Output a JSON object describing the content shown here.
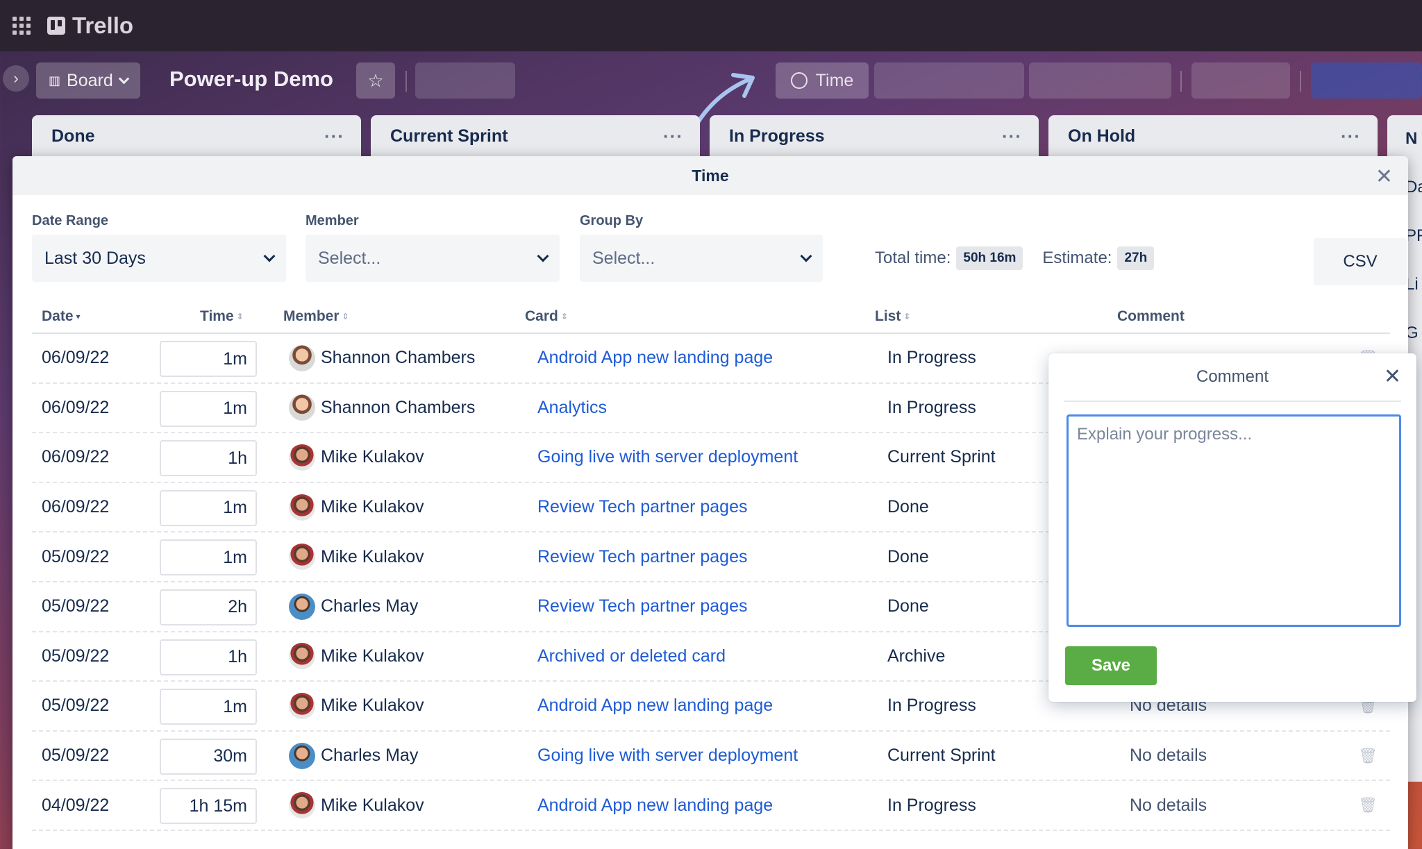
{
  "app": {
    "name": "Trello"
  },
  "board": {
    "view_label": "Board",
    "title": "Power-up Demo",
    "time_button_label": "Time"
  },
  "lists": [
    {
      "name": "Done"
    },
    {
      "name": "Current Sprint"
    },
    {
      "name": "In Progress"
    },
    {
      "name": "On Hold"
    },
    {
      "name": "N"
    }
  ],
  "right_list_fragments": [
    "Da",
    "PF",
    "Li",
    "G"
  ],
  "modal": {
    "title": "Time",
    "filters": {
      "date_range": {
        "label": "Date Range",
        "value": "Last 30 Days"
      },
      "member": {
        "label": "Member",
        "placeholder": "Select..."
      },
      "group_by": {
        "label": "Group By",
        "placeholder": "Select..."
      }
    },
    "totals": {
      "total_label": "Total time:",
      "total_value": "50h 16m",
      "estimate_label": "Estimate:",
      "estimate_value": "27h"
    },
    "csv_label": "CSV",
    "columns": [
      "Date",
      "Time",
      "Member",
      "Card",
      "List",
      "Comment"
    ],
    "rows": [
      {
        "date": "06/09/22",
        "time": "1m",
        "member": "Shannon Chambers",
        "avatar": "sc",
        "card": "Android App new landing page",
        "list": "In Progress",
        "comment": ""
      },
      {
        "date": "06/09/22",
        "time": "1m",
        "member": "Shannon Chambers",
        "avatar": "sc",
        "card": "Analytics",
        "list": "In Progress",
        "comment": ""
      },
      {
        "date": "06/09/22",
        "time": "1h",
        "member": "Mike Kulakov",
        "avatar": "mk",
        "card": "Going live with server deployment",
        "list": "Current Sprint",
        "comment": ""
      },
      {
        "date": "06/09/22",
        "time": "1m",
        "member": "Mike Kulakov",
        "avatar": "mk",
        "card": "Review Tech partner pages",
        "list": "Done",
        "comment": ""
      },
      {
        "date": "05/09/22",
        "time": "1m",
        "member": "Mike Kulakov",
        "avatar": "mk",
        "card": "Review Tech partner pages",
        "list": "Done",
        "comment": ""
      },
      {
        "date": "05/09/22",
        "time": "2h",
        "member": "Charles May",
        "avatar": "cm",
        "card": "Review Tech partner pages",
        "list": "Done",
        "comment": ""
      },
      {
        "date": "05/09/22",
        "time": "1h",
        "member": "Mike Kulakov",
        "avatar": "mk",
        "card": "Archived or deleted card",
        "list": "Archive",
        "comment": ""
      },
      {
        "date": "05/09/22",
        "time": "1m",
        "member": "Mike Kulakov",
        "avatar": "mk",
        "card": "Android App new landing page",
        "list": "In Progress",
        "comment": "No details"
      },
      {
        "date": "05/09/22",
        "time": "30m",
        "member": "Charles May",
        "avatar": "cm",
        "card": "Going live with server deployment",
        "list": "Current Sprint",
        "comment": "No details"
      },
      {
        "date": "04/09/22",
        "time": "1h 15m",
        "member": "Mike Kulakov",
        "avatar": "mk",
        "card": "Android App new landing page",
        "list": "In Progress",
        "comment": "No details"
      }
    ]
  },
  "comment_popover": {
    "title": "Comment",
    "placeholder": "Explain your progress...",
    "save_label": "Save"
  },
  "colors": {
    "link": "#1d5bd6",
    "save_button": "#5aac44",
    "focus_border": "#4c8ae6",
    "appbar": "#2c2331"
  }
}
